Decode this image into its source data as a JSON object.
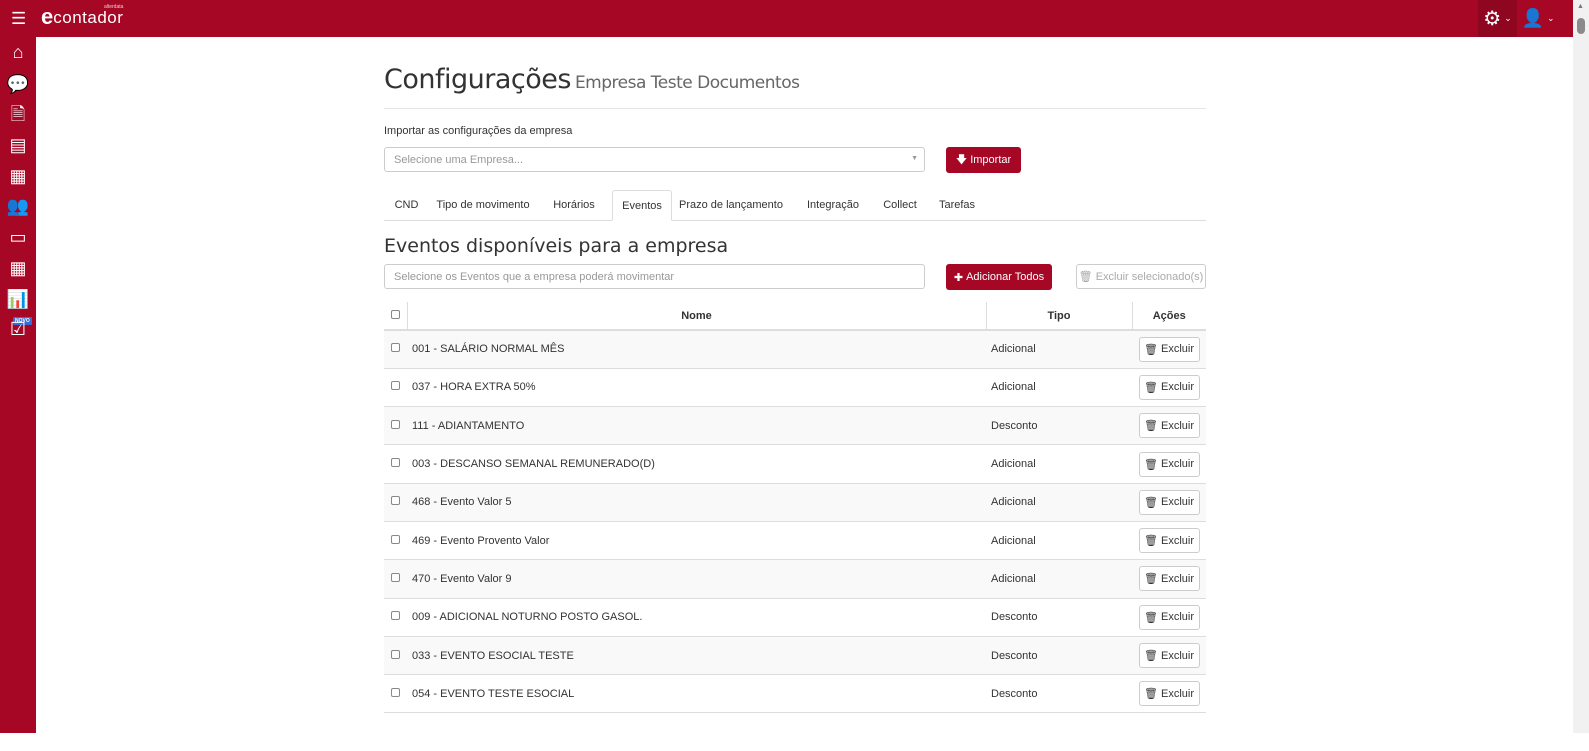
{
  "header": {
    "logo_text": "contador",
    "logo_sub": "alterdata"
  },
  "page": {
    "title": "Configurações",
    "subtitle": "Empresa Teste Documentos"
  },
  "import": {
    "label": "Importar as configurações da empresa",
    "placeholder": "Selecione uma Empresa...",
    "button": "Importar"
  },
  "tabs": [
    "CND",
    "Tipo de movimento",
    "Horários",
    "Eventos",
    "Prazo de lançamento",
    "Integração",
    "Collect",
    "Tarefas"
  ],
  "active_tab": "Eventos",
  "section": {
    "title": "Eventos disponíveis para a empresa",
    "placeholder": "Selecione os Eventos que a empresa poderá movimentar",
    "add_all": "Adicionar Todos",
    "delete_selected": "Excluir selecionado(s)"
  },
  "table": {
    "headers": [
      "Nome",
      "Tipo",
      "Ações"
    ],
    "action_label": "Excluir",
    "rows": [
      {
        "nome": "001 - SALÁRIO NORMAL MÊS",
        "tipo": "Adicional"
      },
      {
        "nome": "037 - HORA EXTRA 50%",
        "tipo": "Adicional"
      },
      {
        "nome": "111 - ADIANTAMENTO",
        "tipo": "Desconto"
      },
      {
        "nome": "003 - DESCANSO SEMANAL REMUNERADO(D)",
        "tipo": "Adicional"
      },
      {
        "nome": "468 - Evento Valor 5",
        "tipo": "Adicional"
      },
      {
        "nome": "469 - Evento Provento Valor",
        "tipo": "Adicional"
      },
      {
        "nome": "470 - Evento Valor 9",
        "tipo": "Adicional"
      },
      {
        "nome": "009 - ADICIONAL NOTURNO POSTO GASOL.",
        "tipo": "Desconto"
      },
      {
        "nome": "033 - EVENTO ESOCIAL TESTE",
        "tipo": "Desconto"
      },
      {
        "nome": "054 - EVENTO TESTE ESOCIAL",
        "tipo": "Desconto"
      }
    ]
  },
  "sidebar": {
    "badge": "NOVO",
    "icons": [
      "home-icon",
      "comments-icon",
      "document-icon",
      "id-card-icon",
      "building-icon",
      "users-icon",
      "credit-card-icon",
      "calculator-icon",
      "bar-chart-icon",
      "checkbox-icon"
    ]
  },
  "colors": {
    "brand": "#a50725"
  }
}
